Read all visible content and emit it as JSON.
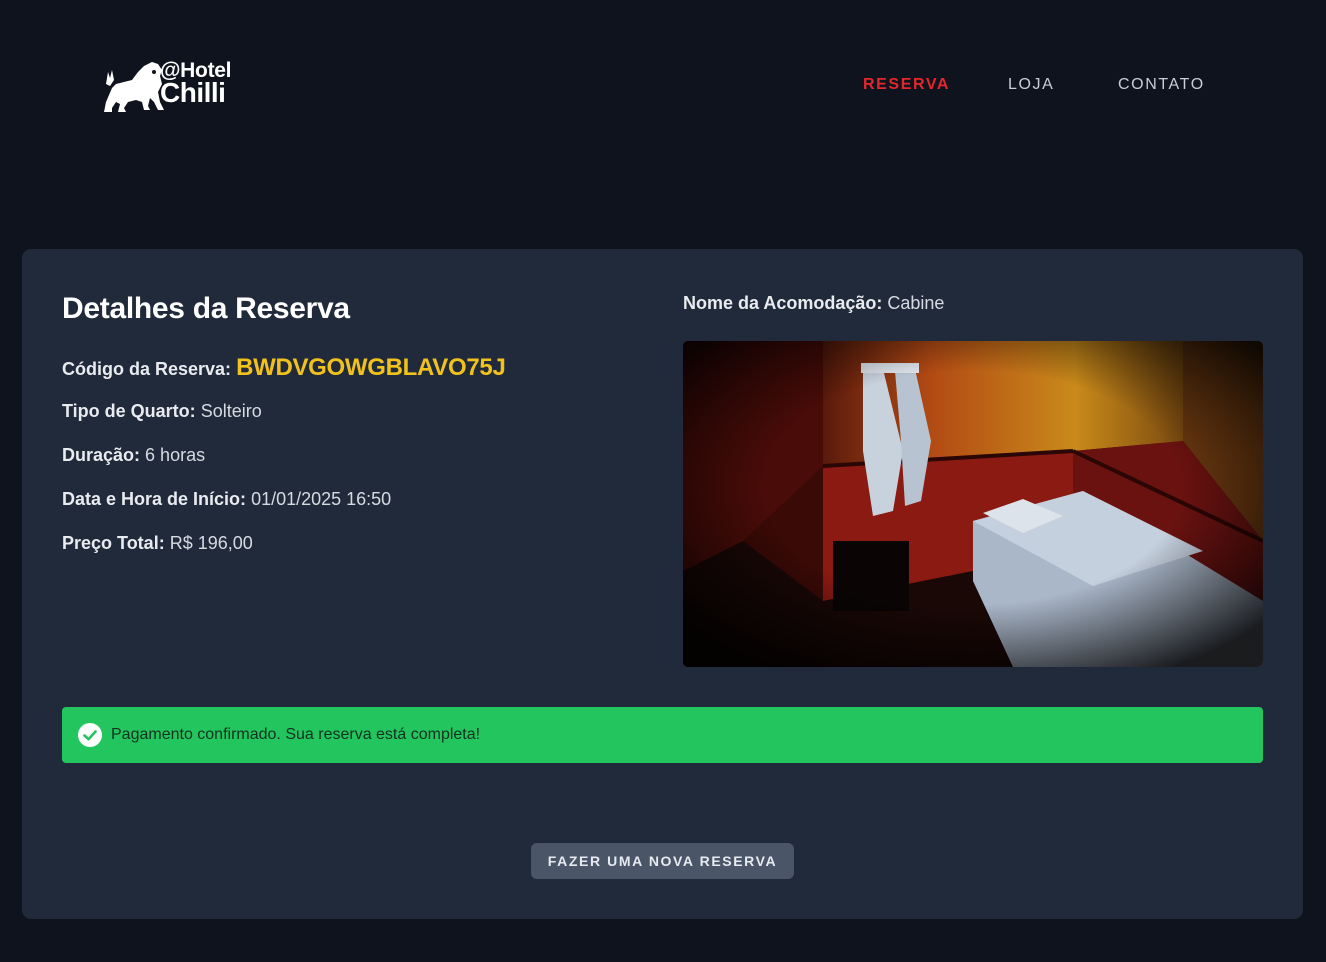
{
  "brand": {
    "line1": "@Hotel",
    "line2": "Chilli"
  },
  "nav": {
    "items": [
      {
        "label": "RESERVA",
        "active": true
      },
      {
        "label": "LOJA",
        "active": false
      },
      {
        "label": "CONTATO",
        "active": false
      }
    ]
  },
  "reservation": {
    "title": "Detalhes da Reserva",
    "code_label": "Código da Reserva:",
    "code_value": "BWDVGOWGBLAVO75J",
    "room_type_label": "Tipo de Quarto:",
    "room_type_value": "Solteiro",
    "duration_label": "Duração:",
    "duration_value": "6 horas",
    "start_label": "Data e Hora de Início:",
    "start_value": "01/01/2025 16:50",
    "price_label": "Preço Total:",
    "price_value": "R$ 196,00",
    "accommodation_label": "Nome da Acomodação:",
    "accommodation_value": "Cabine"
  },
  "alert": {
    "message": "Pagamento confirmado. Sua reserva está completa!"
  },
  "actions": {
    "new_reservation": "FAZER UMA NOVA RESERVA"
  },
  "colors": {
    "background": "#0e131d",
    "card": "#212a3a",
    "accent_red": "#e5262d",
    "code_yellow": "#f2c21c",
    "success_green": "#22c55e",
    "button_gray": "#4a5568"
  },
  "icons": {
    "logo": "lion-icon",
    "alert": "check-circle-icon"
  }
}
